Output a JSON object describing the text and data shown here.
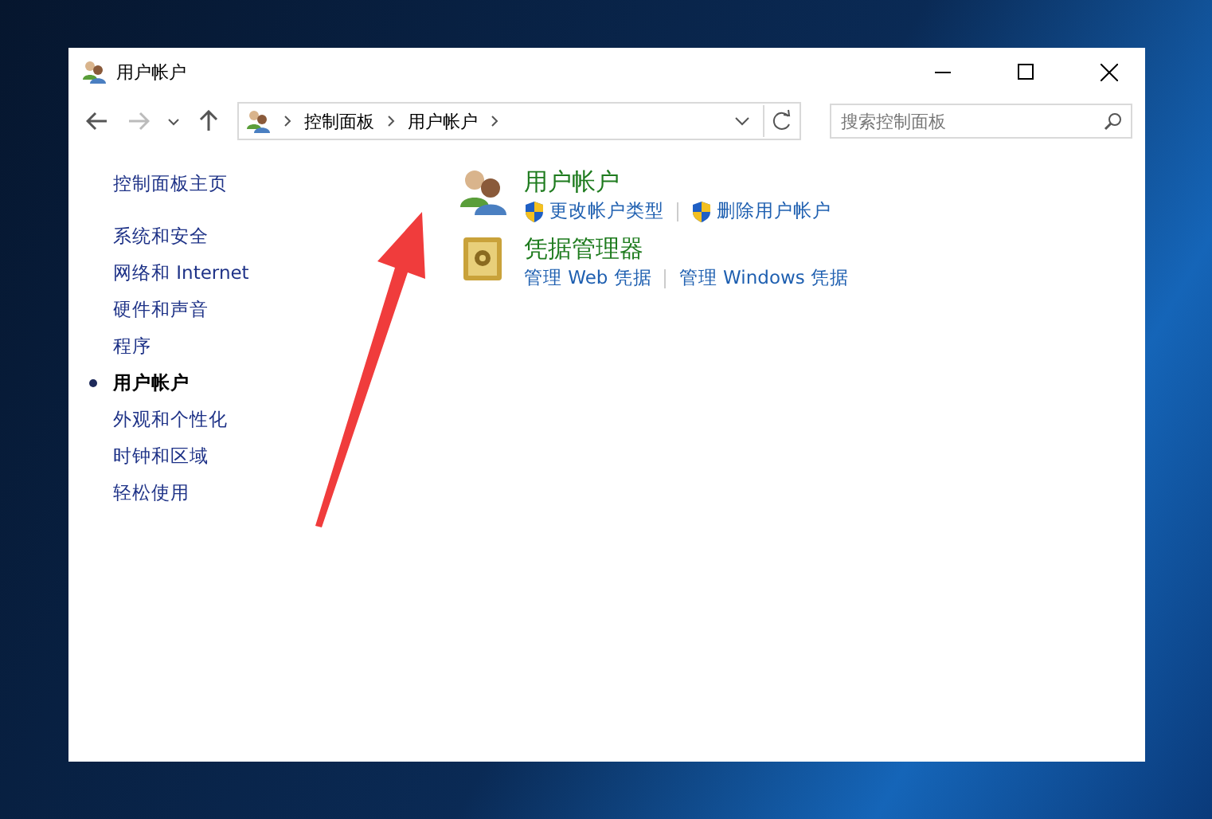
{
  "window": {
    "title": "用户帐户"
  },
  "address_bar": {
    "breadcrumbs": [
      "控制面板",
      "用户帐户"
    ]
  },
  "search": {
    "placeholder": "搜索控制面板"
  },
  "sidebar": {
    "home": "控制面板主页",
    "items": [
      {
        "label": "系统和安全",
        "selected": false
      },
      {
        "label": "网络和 Internet",
        "selected": false
      },
      {
        "label": "硬件和声音",
        "selected": false
      },
      {
        "label": "程序",
        "selected": false
      },
      {
        "label": "用户帐户",
        "selected": true
      },
      {
        "label": "外观和个性化",
        "selected": false
      },
      {
        "label": "时钟和区域",
        "selected": false
      },
      {
        "label": "轻松使用",
        "selected": false
      }
    ]
  },
  "categories": [
    {
      "kind": "users",
      "title": "用户帐户",
      "links": [
        {
          "label": "更改帐户类型",
          "kind": "admin"
        },
        {
          "label": "删除用户帐户",
          "kind": "admin"
        }
      ]
    },
    {
      "kind": "vault",
      "title": "凭据管理器",
      "links": [
        {
          "label": "管理 Web 凭据",
          "kind": "plain"
        },
        {
          "label": "管理 Windows 凭据",
          "kind": "plain"
        }
      ]
    }
  ]
}
